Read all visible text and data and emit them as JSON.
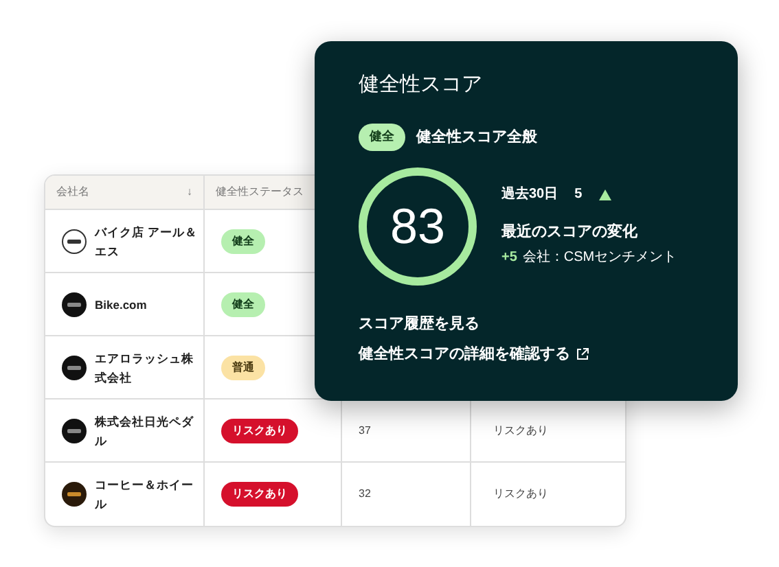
{
  "table": {
    "columns": [
      {
        "label": "会社名",
        "sort_icon": "↓"
      },
      {
        "label": "健全性ステータス"
      }
    ],
    "rows": [
      {
        "kind": "outline_logo",
        "name": "バイク店 アール＆エス",
        "status": {
          "label": "健全",
          "kind": "healthy"
        }
      },
      {
        "kind": "dark_logo",
        "name": "Bike.com",
        "status": {
          "label": "健全",
          "kind": "healthy"
        }
      },
      {
        "kind": "dark_logo",
        "name": "エアロラッシュ株式会社",
        "status": {
          "label": "普通",
          "kind": "normal"
        }
      },
      {
        "kind": "dark_logo",
        "name": "株式会社日光ペダル",
        "status": {
          "label": "リスクあり",
          "kind": "risk"
        },
        "column_3": "37",
        "column_4": "リスクあり"
      },
      {
        "kind": "brown_logo",
        "name": "コーヒー＆ホイール",
        "status": {
          "label": "リスクあり",
          "kind": "risk"
        },
        "column_3": "32",
        "column_4": "リスクあり"
      }
    ]
  },
  "score_card": {
    "title": "健全性スコア",
    "badge": "健全",
    "subtitle": "健全性スコア全般",
    "score": "83",
    "period": "過去30日",
    "period_change": "5",
    "change_title": "最近のスコアの変化",
    "change_value": "+5",
    "change_source": "会社：CSMセンチメント",
    "links": [
      {
        "label": "スコア履歴を見る",
        "external": false
      },
      {
        "label": "健全性スコアの詳細を確認する",
        "external": true
      }
    ]
  }
}
